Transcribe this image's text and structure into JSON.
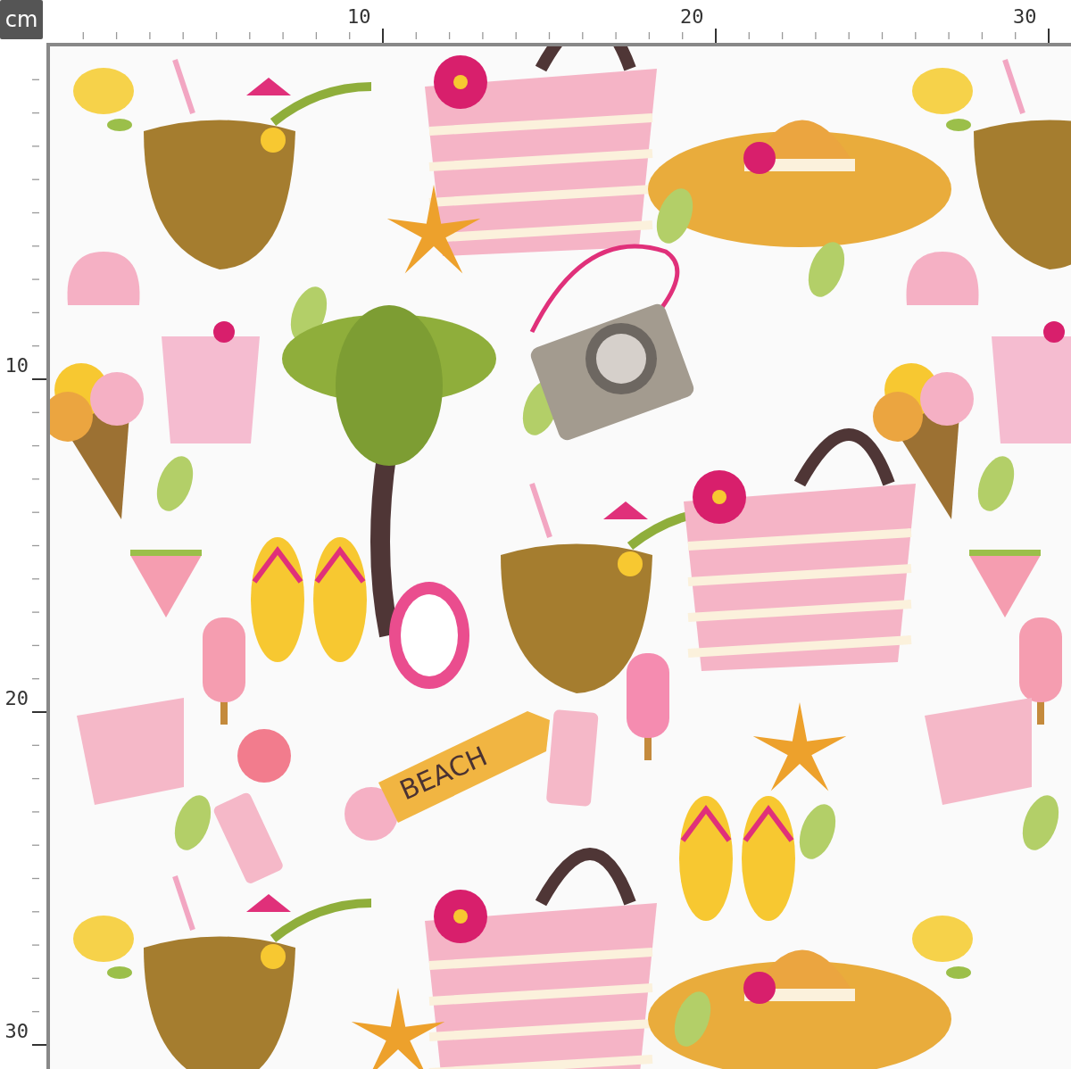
{
  "unit_label": "cm",
  "horizontal_ruler": {
    "labels": [
      "10",
      "20",
      "30"
    ]
  },
  "vertical_ruler": {
    "labels": [
      "10",
      "20",
      "30"
    ]
  },
  "fabric": {
    "sign_text": "BEACH"
  }
}
